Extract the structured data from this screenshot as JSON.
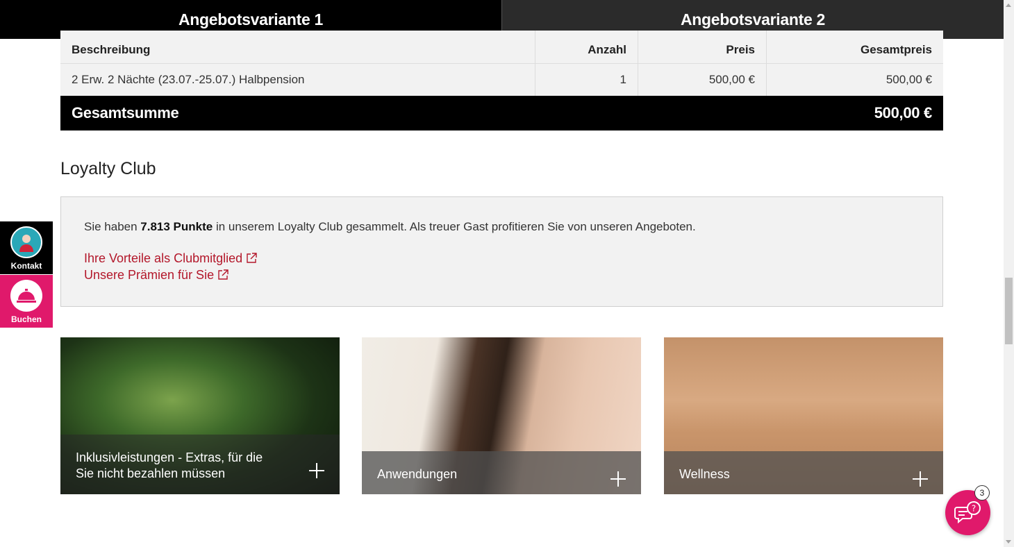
{
  "tabs": [
    {
      "label": "Angebotsvariante 1",
      "active": true
    },
    {
      "label": "Angebotsvariante 2",
      "active": false
    }
  ],
  "offer_table": {
    "headers": [
      "Beschreibung",
      "Anzahl",
      "Preis",
      "Gesamtpreis"
    ],
    "rows": [
      [
        "2 Erw. 2 Nächte (23.07.-25.07.) Halbpension",
        "1",
        "500,00 €",
        "500,00 €"
      ]
    ],
    "total_label": "Gesamtsumme",
    "total_value": "500,00 €"
  },
  "loyalty": {
    "title": "Loyalty Club",
    "text_before": "Sie haben ",
    "points": "7.813 Punkte",
    "text_after": " in unserem Loyalty Club gesammelt. Als treuer Gast profitieren Sie von unseren Angeboten.",
    "links": [
      {
        "label": "Ihre Vorteile als Clubmitglied",
        "icon": "external-link-icon"
      },
      {
        "label": "Unsere Prämien für Sie",
        "icon": "external-link-icon"
      }
    ]
  },
  "cards": [
    {
      "caption": "Inklusivleistungen - Extras, für die Sie nicht bezahlen müssen",
      "icon": "plus-icon"
    },
    {
      "caption": "Anwendungen",
      "icon": "plus-icon"
    },
    {
      "caption": "Wellness",
      "icon": "plus-icon"
    }
  ],
  "side": {
    "kontakt_label": "Kontakt",
    "buchen_label": "Buchen"
  },
  "chat": {
    "badge": "3",
    "icon": "chat-help-icon"
  },
  "colors": {
    "accent_pink": "#e0196b",
    "link_red": "#b3172a",
    "black": "#000000"
  }
}
